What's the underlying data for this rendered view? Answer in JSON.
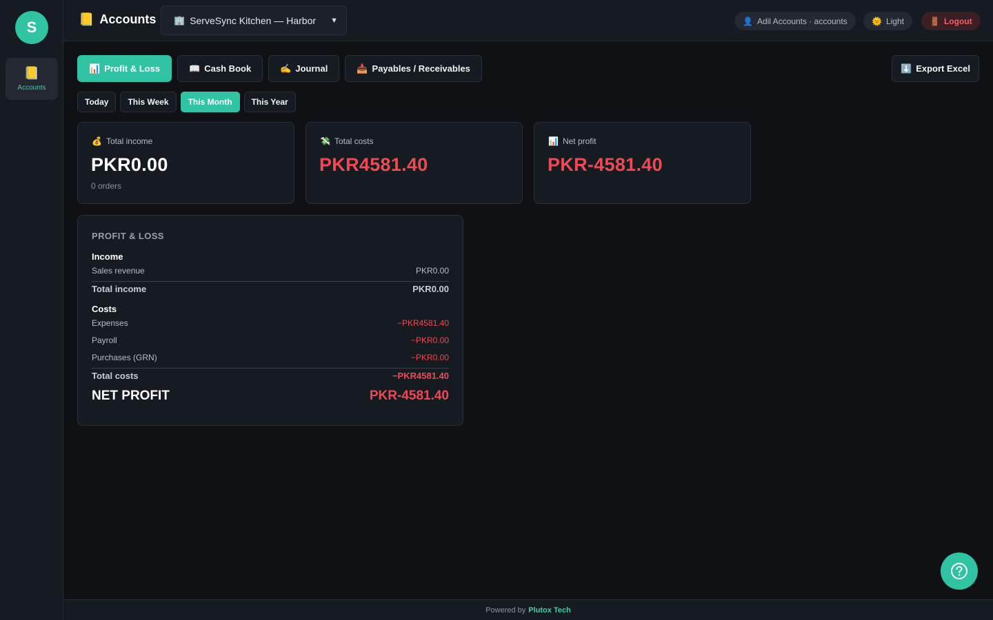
{
  "sidebar": {
    "brand_initial": "S",
    "items": [
      {
        "icon": "ledger-icon",
        "label": "Accounts"
      }
    ]
  },
  "header": {
    "title": "Accounts",
    "branch": "ServeSync Kitchen — Harbor",
    "user": "Adil Accounts · accounts",
    "theme": "Light",
    "logout": "Logout"
  },
  "tabs": [
    "Profit & Loss",
    "Cash Book",
    "Journal",
    "Payables / Receivables"
  ],
  "active_tab": "Profit & Loss",
  "export_label": "Export Excel",
  "periods": [
    "Today",
    "This Week",
    "This Month",
    "This Year"
  ],
  "active_period": "This Month",
  "cards": {
    "income": {
      "label": "Total income",
      "value": "PKR0.00",
      "sub": "0 orders"
    },
    "costs": {
      "label": "Total costs",
      "value": "PKR4581.40"
    },
    "net": {
      "label": "Net profit",
      "value": "PKR-4581.40"
    }
  },
  "pl": {
    "title": "PROFIT & LOSS",
    "income_heading": "Income",
    "sales_label": "Sales revenue",
    "sales_value": "PKR0.00",
    "total_income_label": "Total income",
    "total_income_value": "PKR0.00",
    "costs_heading": "Costs",
    "expenses_label": "Expenses",
    "expenses_value": "−PKR4581.40",
    "payroll_label": "Payroll",
    "payroll_value": "−PKR0.00",
    "purchases_label": "Purchases (GRN)",
    "purchases_value": "−PKR0.00",
    "total_costs_label": "Total costs",
    "total_costs_value": "−PKR4581.40",
    "net_label": "NET PROFIT",
    "net_value": "PKR-4581.40"
  },
  "footer": {
    "prefix": "Powered by",
    "brand": "Plutox Tech"
  },
  "colors": {
    "accent": "#2fc2a3",
    "negative": "#ef4a53",
    "background": "#0f1115",
    "panel": "#161a21"
  }
}
